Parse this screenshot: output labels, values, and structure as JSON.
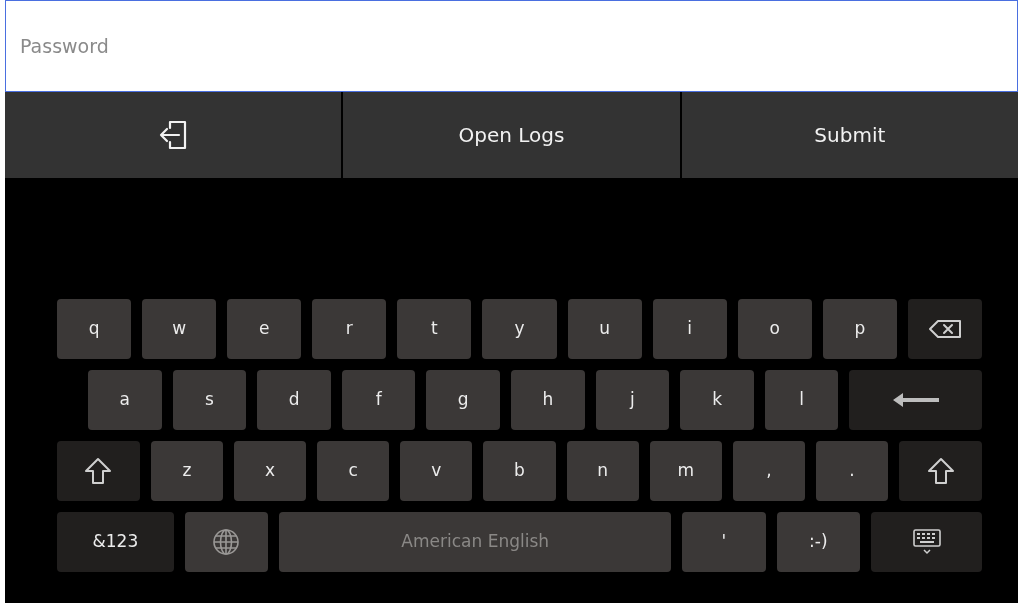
{
  "password_field": {
    "placeholder": "Password"
  },
  "action_bar": [
    {
      "kind": "exit"
    },
    {
      "kind": "text",
      "label": "Open Logs"
    },
    {
      "kind": "text",
      "label": "Submit"
    }
  ],
  "keyboard": {
    "rows": [
      {
        "keys": [
          {
            "kind": "char",
            "label": "q"
          },
          {
            "kind": "char",
            "label": "w"
          },
          {
            "kind": "char",
            "label": "e"
          },
          {
            "kind": "char",
            "label": "r"
          },
          {
            "kind": "char",
            "label": "t"
          },
          {
            "kind": "char",
            "label": "y"
          },
          {
            "kind": "char",
            "label": "u"
          },
          {
            "kind": "char",
            "label": "i"
          },
          {
            "kind": "char",
            "label": "o"
          },
          {
            "kind": "char",
            "label": "p"
          },
          {
            "kind": "backspace"
          }
        ]
      },
      {
        "keys": [
          {
            "kind": "char",
            "label": "a"
          },
          {
            "kind": "char",
            "label": "s"
          },
          {
            "kind": "char",
            "label": "d"
          },
          {
            "kind": "char",
            "label": "f"
          },
          {
            "kind": "char",
            "label": "g"
          },
          {
            "kind": "char",
            "label": "h"
          },
          {
            "kind": "char",
            "label": "j"
          },
          {
            "kind": "char",
            "label": "k"
          },
          {
            "kind": "char",
            "label": "l"
          },
          {
            "kind": "enter"
          }
        ]
      },
      {
        "keys": [
          {
            "kind": "shift"
          },
          {
            "kind": "char",
            "label": "z"
          },
          {
            "kind": "char",
            "label": "x"
          },
          {
            "kind": "char",
            "label": "c"
          },
          {
            "kind": "char",
            "label": "v"
          },
          {
            "kind": "char",
            "label": "b"
          },
          {
            "kind": "char",
            "label": "n"
          },
          {
            "kind": "char",
            "label": "m"
          },
          {
            "kind": "char",
            "label": ","
          },
          {
            "kind": "char",
            "label": "."
          },
          {
            "kind": "shift"
          }
        ]
      },
      {
        "keys": [
          {
            "kind": "symbols",
            "label": "&123"
          },
          {
            "kind": "globe"
          },
          {
            "kind": "space",
            "label": "American English"
          },
          {
            "kind": "char",
            "label": "'"
          },
          {
            "kind": "char",
            "label": ":-)"
          },
          {
            "kind": "hide"
          }
        ]
      }
    ]
  }
}
